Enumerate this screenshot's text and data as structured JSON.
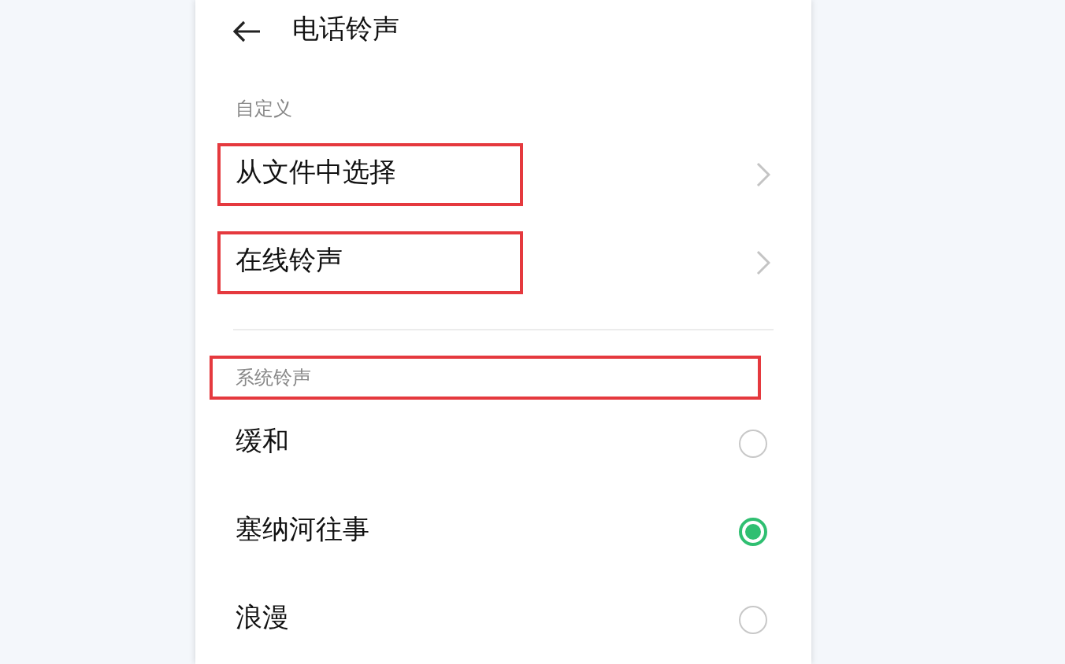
{
  "header": {
    "title": "电话铃声"
  },
  "sections": [
    {
      "header": "自定义",
      "highlighted": false,
      "items": [
        {
          "kind": "link",
          "label": "从文件中选择",
          "highlighted": true
        },
        {
          "kind": "link",
          "label": "在线铃声",
          "highlighted": true
        }
      ]
    },
    {
      "header": "系统铃声",
      "highlighted": true,
      "items": [
        {
          "kind": "radio",
          "label": "缓和",
          "selected": false
        },
        {
          "kind": "radio",
          "label": "塞纳河往事",
          "selected": true
        },
        {
          "kind": "radio",
          "label": "浪漫",
          "selected": false
        }
      ]
    }
  ]
}
